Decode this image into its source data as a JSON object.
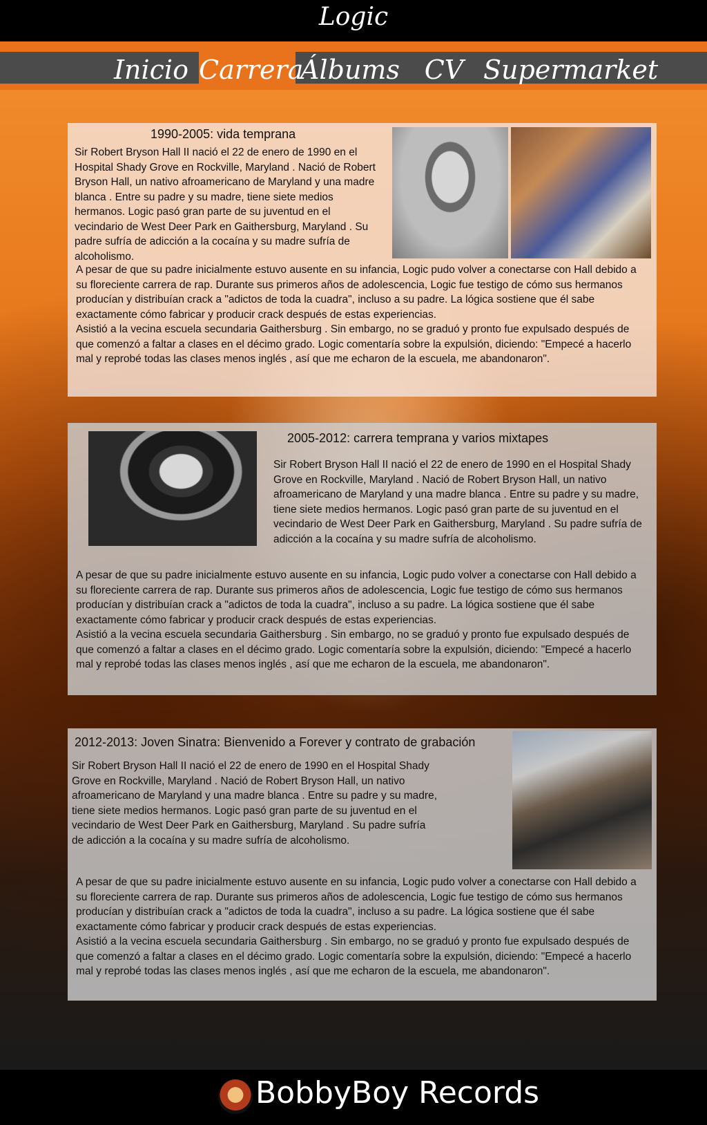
{
  "brand": {
    "title": "Logic"
  },
  "nav": {
    "items": [
      {
        "label": "Inicio"
      },
      {
        "label": "Carrera"
      },
      {
        "label": "Álbums"
      },
      {
        "label": "CV"
      },
      {
        "label": "Supermarket"
      }
    ],
    "active": "Carrera"
  },
  "sections": [
    {
      "title": "1990-2005: vida temprana",
      "intro": "Sir Robert Bryson Hall II nació el 22 de enero de 1990 en el Hospital Shady Grove en Rockville, Maryland . Nació de Robert Bryson Hall, un nativo afroamericano de Maryland y una madre blanca . Entre su padre y su madre, tiene siete medios hermanos. Logic pasó gran parte de su juventud en el vecindario de West Deer Park en Gaithersburg, Maryland . Su padre sufría de adicción a la cocaína y su madre sufría de alcoholismo.",
      "body": "A pesar de que su padre inicialmente estuvo ausente en su infancia, Logic pudo volver a conectarse con Hall debido a su floreciente carrera de rap. Durante sus primeros años de adolescencia, Logic fue testigo de cómo sus hermanos producían y distribuían crack a \"adictos de toda la cuadra\",  incluso a su padre. La lógica sostiene que él sabe exactamente cómo fabricar y producir crack después de estas experiencias.\nAsistió a la vecina escuela secundaria Gaithersburg . Sin embargo, no se graduó y pronto fue expulsado después de que comenzó a faltar a clases en el décimo grado. Logic comentaría sobre la expulsión, diciendo: \"Empecé a hacerlo mal y reprobé todas las clases menos inglés , así que me echaron de la escuela, me abandonaron\"."
    },
    {
      "title": "2005-2012: carrera temprana y varios mixtapes",
      "intro": "Sir Robert Bryson Hall II nació el 22 de enero de 1990 en el Hospital Shady Grove en Rockville, Maryland . Nació de Robert Bryson Hall, un nativo afroamericano de Maryland y una madre blanca . Entre su padre y su madre, tiene siete medios hermanos. Logic pasó gran parte de su juventud en el vecindario de West Deer Park en Gaithersburg, Maryland . Su padre sufría de adicción a la cocaína y su madre sufría de alcoholismo.",
      "body": "A pesar de que su padre inicialmente estuvo ausente en su infancia, Logic pudo volver a conectarse con Hall debido a su floreciente carrera de rap. Durante sus primeros años de adolescencia, Logic fue testigo de cómo sus hermanos producían y distribuían crack a \"adictos de toda la cuadra\",  incluso a su padre. La lógica sostiene que él sabe exactamente cómo fabricar y producir crack después de estas experiencias.\nAsistió a la vecina escuela secundaria Gaithersburg . Sin embargo, no se graduó y pronto fue expulsado después de que comenzó a faltar a clases en el décimo grado. Logic comentaría sobre la expulsión, diciendo: \"Empecé a hacerlo mal y reprobé todas las clases menos inglés , así que me echaron de la escuela, me abandonaron\"."
    },
    {
      "title": "2012-2013: Joven Sinatra: Bienvenido a Forever y contrato de grabación",
      "intro": "Sir Robert Bryson Hall II nació el 22 de enero de 1990 en el Hospital Shady Grove en Rockville, Maryland . Nació de Robert Bryson Hall, un nativo afroamericano de Maryland y una madre blanca . Entre su padre y su madre, tiene siete medios hermanos. Logic pasó gran parte de su juventud en el vecindario de West Deer Park en Gaithersburg, Maryland . Su padre sufría de adicción a la cocaína y su madre sufría de alcoholismo.",
      "body": "A pesar de que su padre inicialmente estuvo ausente en su infancia, Logic pudo volver a conectarse con Hall debido a su floreciente carrera de rap. Durante sus primeros años de adolescencia, Logic fue testigo de cómo sus hermanos producían y distribuían crack a \"adictos de toda la cuadra\",  incluso a su padre. La lógica sostiene que él sabe exactamente cómo fabricar y producir crack después de estas experiencias.\nAsistió a la vecina escuela secundaria Gaithersburg . Sin embargo, no se graduó y pronto fue expulsado después de que comenzó a faltar a clases en el décimo grado. Logic comentaría sobre la expulsión, diciendo: \"Empecé a hacerlo mal y reprobé todas las clases menos inglés , así que me echaron de la escuela, me abandonaron\"."
    }
  ],
  "footer": {
    "label": "BobbyBoy Records"
  },
  "colors": {
    "accent": "#e8731c",
    "navStrip": "#4b4b4b",
    "bar": "#000000"
  }
}
